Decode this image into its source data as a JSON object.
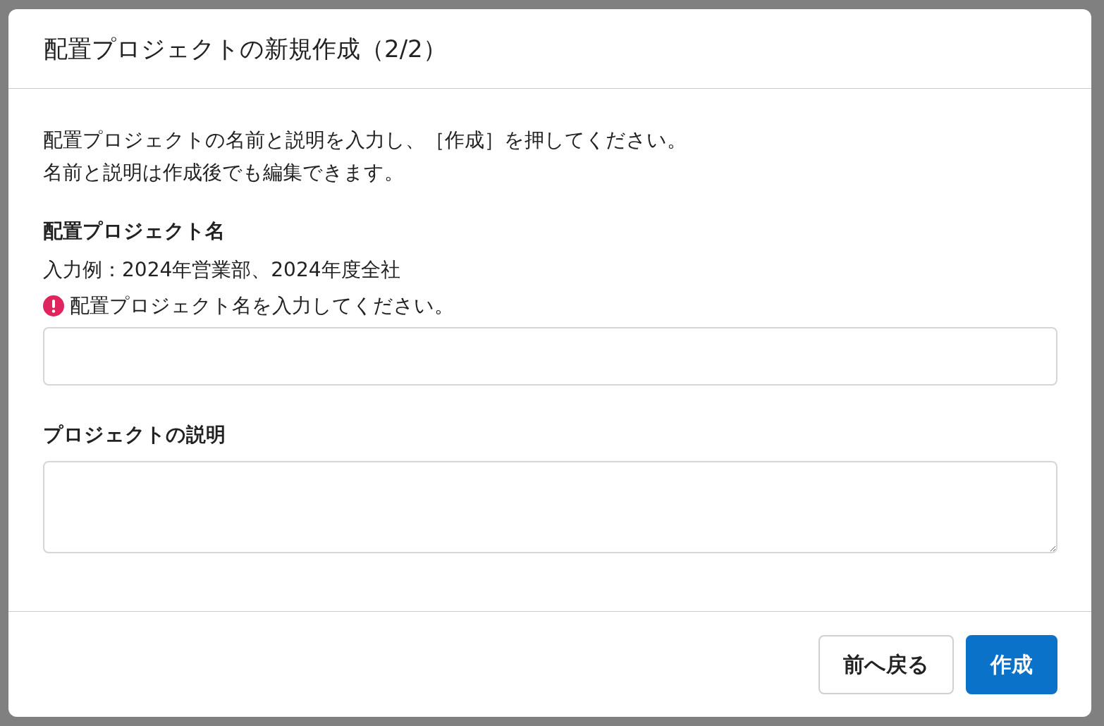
{
  "dialog": {
    "title": "配置プロジェクトの新規作成（2/2）",
    "instructions": [
      "配置プロジェクトの名前と説明を入力し、［作成］を押してください。",
      "名前と説明は作成後でも編集できます。"
    ],
    "fields": [
      {
        "kind": "input",
        "label": "配置プロジェクト名",
        "hint": "入力例：2024年営業部、2024年度全社",
        "error": "配置プロジェクト名を入力してください。"
      },
      {
        "kind": "textarea",
        "label": "プロジェクトの説明"
      }
    ],
    "buttons": [
      {
        "label": "前へ戻る",
        "kind": "secondary"
      },
      {
        "label": "作成",
        "kind": "primary"
      }
    ]
  }
}
